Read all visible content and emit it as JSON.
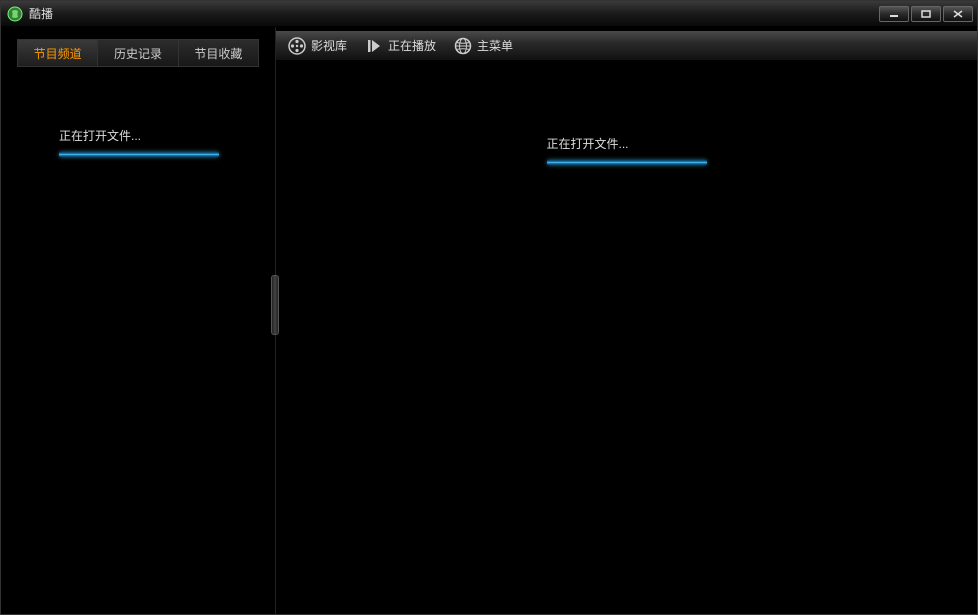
{
  "app": {
    "title": "酷播"
  },
  "sidebar": {
    "tabs": [
      {
        "label": "节目频道",
        "active": true
      },
      {
        "label": "历史记录",
        "active": false
      },
      {
        "label": "节目收藏",
        "active": false
      }
    ],
    "loading_text": "正在打开文件..."
  },
  "toolbar": {
    "items": [
      {
        "label": "影视库",
        "icon": "film-reel-icon"
      },
      {
        "label": "正在播放",
        "icon": "play-icon"
      },
      {
        "label": "主菜单",
        "icon": "globe-icon"
      }
    ]
  },
  "main": {
    "loading_text": "正在打开文件..."
  },
  "colors": {
    "accent": "#ff9a00",
    "progress": "#44c8ff"
  }
}
